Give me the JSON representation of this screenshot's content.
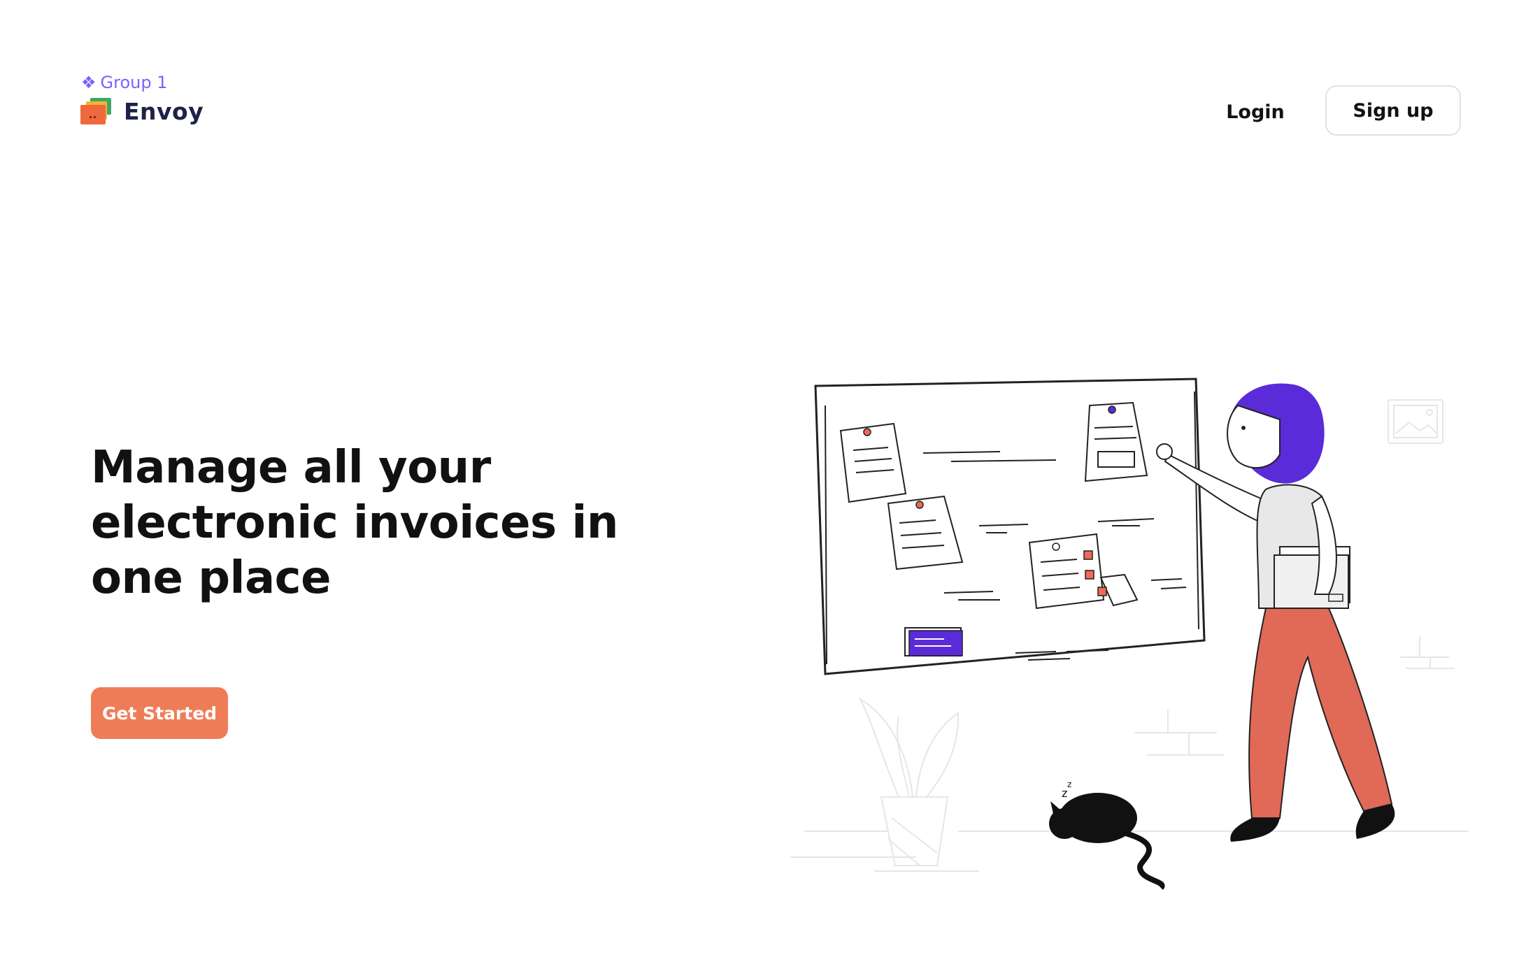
{
  "frame_tag": {
    "label": "Group 1",
    "icon": "component-diamond-icon"
  },
  "brand": {
    "name": "Envoy",
    "icon": "stacked-folders-logo"
  },
  "nav": {
    "login_label": "Login",
    "signup_label": "Sign up"
  },
  "hero": {
    "title_lines": [
      "Manage all your",
      "electronic invoices in",
      "one place"
    ],
    "cta_label": "Get Started"
  },
  "colors": {
    "accent": "#ee7d57",
    "brand_text": "#1f2147",
    "purple": "#5a2bd8",
    "frame_tag": "#7b61ff",
    "pants": "#e06a57"
  }
}
